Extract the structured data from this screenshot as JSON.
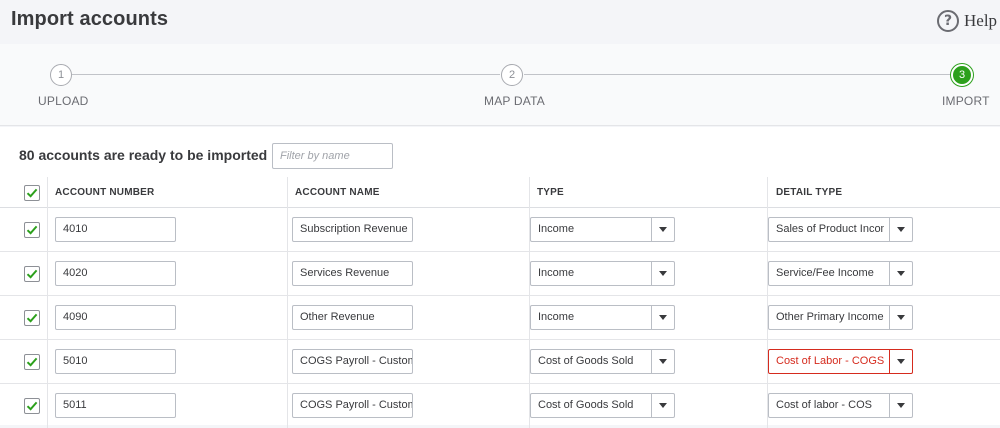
{
  "header": {
    "title": "Import accounts",
    "help_icon": "question-icon",
    "help_label": "Help",
    "help_glyph": "?"
  },
  "stepper": {
    "steps": [
      {
        "number": "1",
        "label": "UPLOAD",
        "state": "done"
      },
      {
        "number": "2",
        "label": "MAP DATA",
        "state": "done"
      },
      {
        "number": "3",
        "label": "IMPORT",
        "state": "current"
      }
    ],
    "active_color": "#2ca01c"
  },
  "main": {
    "ready_text": "80 accounts are ready to be imported",
    "filter_placeholder": "Filter by name",
    "filter_value": ""
  },
  "table": {
    "select_all_checked": true,
    "columns": [
      "ACCOUNT NUMBER",
      "ACCOUNT NAME",
      "TYPE",
      "DETAIL TYPE"
    ],
    "rows": [
      {
        "checked": true,
        "number": "4010",
        "name": "Subscription Revenue",
        "type": "Income",
        "detail": "Sales of Product Income",
        "detail_error": false
      },
      {
        "checked": true,
        "number": "4020",
        "name": "Services Revenue",
        "type": "Income",
        "detail": "Service/Fee Income",
        "detail_error": false
      },
      {
        "checked": true,
        "number": "4090",
        "name": "Other Revenue",
        "type": "Income",
        "detail": "Other Primary Income",
        "detail_error": false
      },
      {
        "checked": true,
        "number": "5010",
        "name": "COGS Payroll - Customer Support",
        "type": "Cost of Goods Sold",
        "detail": "Cost of Labor - COGS",
        "detail_error": true
      },
      {
        "checked": true,
        "number": "5011",
        "name": "COGS Payroll - Customer Success",
        "type": "Cost of Goods Sold",
        "detail": "Cost of labor - COS",
        "detail_error": false
      }
    ]
  },
  "colors": {
    "check_green": "#2ca01c",
    "error_red": "#d52b1e"
  }
}
